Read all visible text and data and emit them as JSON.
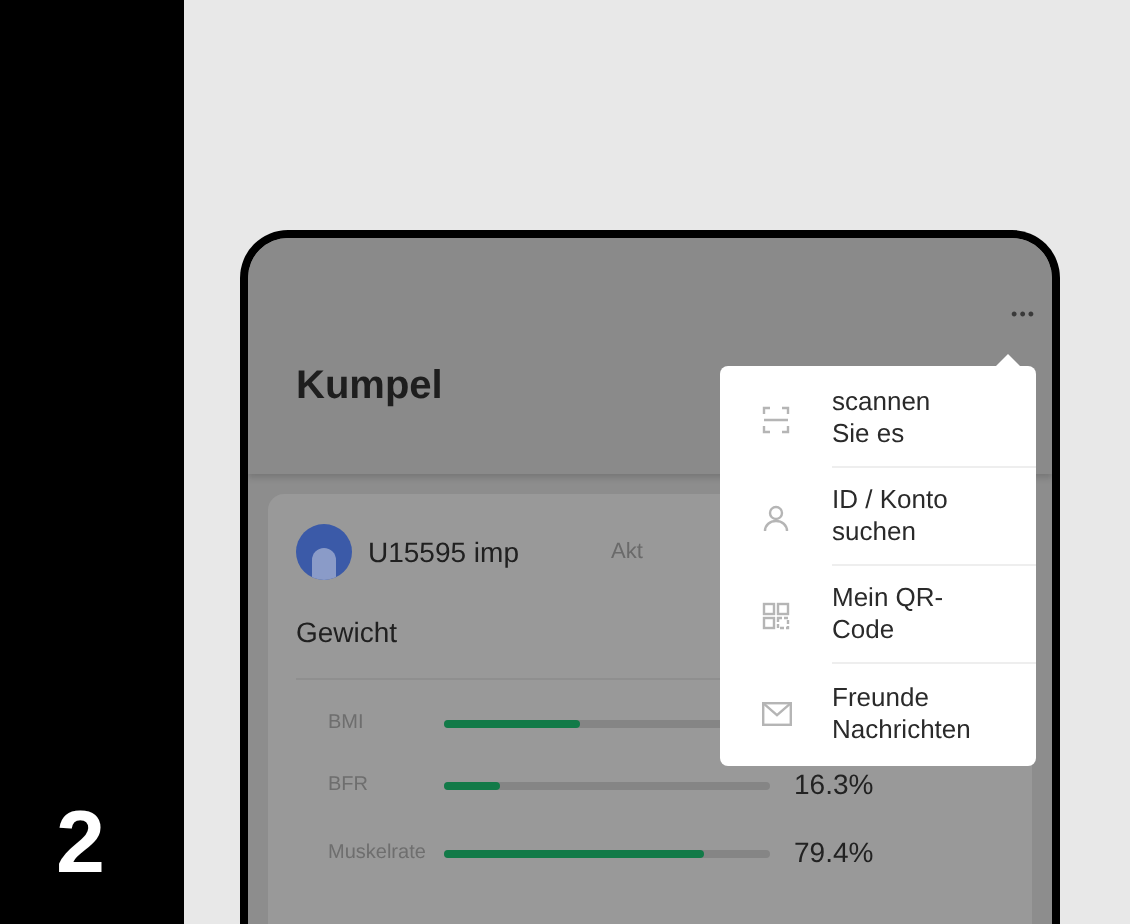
{
  "step": "2",
  "screen": {
    "title": "Kumpel",
    "more": "•••",
    "user": {
      "name": "U15595 imp",
      "status": "Akt"
    },
    "section": "Gewicht",
    "metrics": [
      {
        "label": "BMI",
        "level": 0.42
      },
      {
        "label": "BFR",
        "level": 0.17,
        "value": "16.3%"
      },
      {
        "label": "Muskelrate",
        "level": 0.8,
        "value": "79.4%"
      }
    ]
  },
  "menu": [
    {
      "kind": "scan",
      "label": "scannen\nSie es"
    },
    {
      "kind": "person",
      "label": "ID / Konto\nsuchen"
    },
    {
      "kind": "qr",
      "label": "Mein QR-\nCode"
    },
    {
      "kind": "mail",
      "label": "Freunde\nNachrichten"
    }
  ]
}
